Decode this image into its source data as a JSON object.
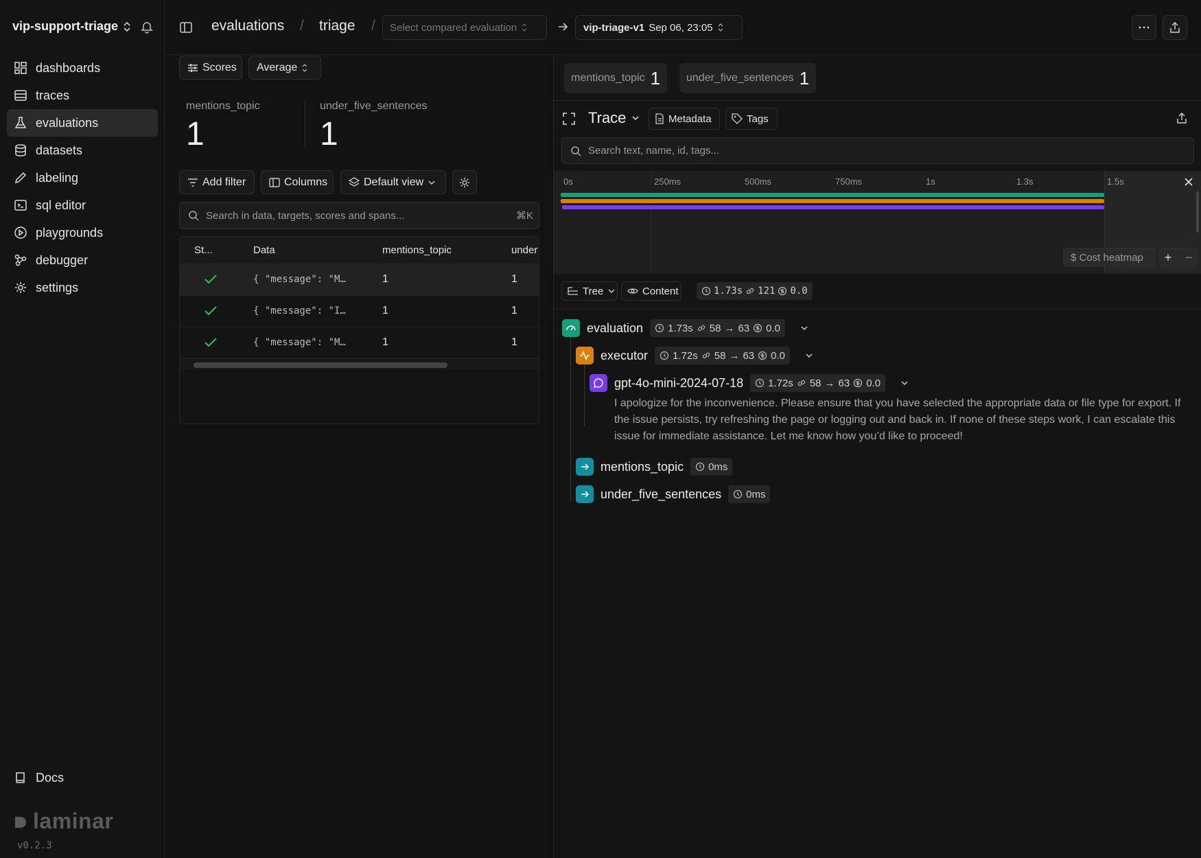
{
  "sidebar": {
    "project": "vip-support-triage",
    "items": [
      {
        "label": "dashboards",
        "icon": "dashboard-icon"
      },
      {
        "label": "traces",
        "icon": "rows-icon"
      },
      {
        "label": "evaluations",
        "icon": "flask-icon",
        "active": true
      },
      {
        "label": "datasets",
        "icon": "database-icon"
      },
      {
        "label": "labeling",
        "icon": "pen-icon"
      },
      {
        "label": "sql editor",
        "icon": "terminal-icon"
      },
      {
        "label": "playgrounds",
        "icon": "play-icon"
      },
      {
        "label": "debugger",
        "icon": "graph-icon"
      },
      {
        "label": "settings",
        "icon": "gear-icon"
      }
    ],
    "docs": "Docs",
    "logo": "laminar",
    "version": "v0.2.3"
  },
  "topbar": {
    "crumb1": "evaluations",
    "crumb2": "triage",
    "compare_placeholder": "Select compared evaluation",
    "current_eval": "vip-triage-v1",
    "current_date": "Sep 06, 23:05"
  },
  "left": {
    "scores_btn": "Scores",
    "agg_select": "Average",
    "stats": [
      {
        "name": "mentions_topic",
        "value": "1"
      },
      {
        "name": "under_five_sentences",
        "value": "1"
      }
    ],
    "add_filter": "Add filter",
    "columns": "Columns",
    "default_view": "Default view",
    "search_placeholder": "Search in data, targets, scores and spans...",
    "search_shortcut": "⌘K",
    "table": {
      "headers": [
        "St...",
        "Data",
        "mentions_topic",
        "under"
      ],
      "rows": [
        {
          "data": "{ \"message\": \"M…",
          "mentions_topic": "1",
          "under": "1"
        },
        {
          "data": "{ \"message\": \"I…",
          "mentions_topic": "1",
          "under": "1"
        },
        {
          "data": "{ \"message\": \"M…",
          "mentions_topic": "1",
          "under": "1"
        }
      ]
    }
  },
  "right": {
    "score_tabs": [
      {
        "name": "mentions_topic",
        "value": "1"
      },
      {
        "name": "under_five_sentences",
        "value": "1"
      }
    ],
    "trace_title": "Trace",
    "metadata": "Metadata",
    "tags": "Tags",
    "search_placeholder": "Search text, name, id, tags...",
    "timeline_ticks": [
      "0s",
      "250ms",
      "500ms",
      "750ms",
      "1s",
      "1.3s",
      "1.5s"
    ],
    "cost_heatmap": "$ Cost heatmap",
    "view_tree": "Tree",
    "view_content": "Content",
    "summary": {
      "duration": "1.73s",
      "tokens": "121",
      "cost": "0.0"
    },
    "spans": [
      {
        "name": "evaluation",
        "duration": "1.73s",
        "tokens_in": "58",
        "tokens_out": "63",
        "cost": "0.0"
      },
      {
        "name": "executor",
        "duration": "1.72s",
        "tokens_in": "58",
        "tokens_out": "63",
        "cost": "0.0"
      },
      {
        "name": "gpt-4o-mini-2024-07-18",
        "duration": "1.72s",
        "tokens_in": "58",
        "tokens_out": "63",
        "cost": "0.0",
        "output": "I apologize for the inconvenience. Please ensure that you have selected the appropriate data or file type for export. If the issue persists, try refreshing the page or logging out and back in. If none of these steps work, I can escalate this issue for immediate assistance. Let me know how you’d like to proceed!"
      },
      {
        "name": "mentions_topic",
        "duration": "0ms"
      },
      {
        "name": "under_five_sentences",
        "duration": "0ms"
      }
    ],
    "colors": {
      "evaluation": "#16a07a",
      "executor": "#d9820f",
      "llm": "#7c3aed",
      "eval_score": "#138e9c"
    }
  }
}
